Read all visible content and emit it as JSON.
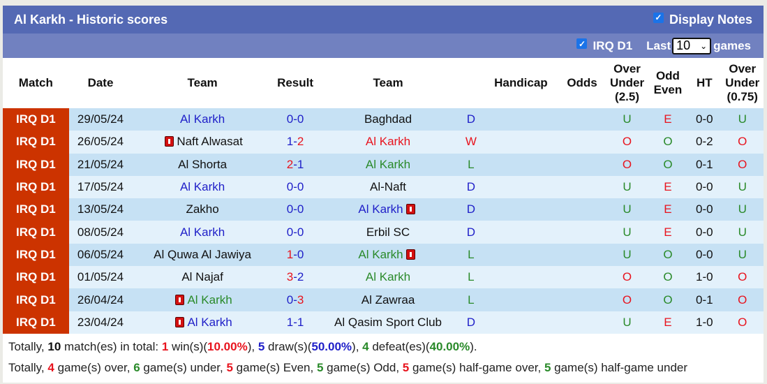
{
  "title": "Al Karkh - Historic scores",
  "display_notes": {
    "label": "Display Notes",
    "checked": true
  },
  "filter": {
    "league_label": "IRQ D1",
    "league_checked": true,
    "last_label": "Last",
    "last_value": "10",
    "games_label": "games"
  },
  "columns": [
    "Match",
    "Date",
    "Team",
    "Result",
    "Team",
    "",
    "Handicap",
    "Odds",
    "Over Under (2.5)",
    "Odd Even",
    "HT",
    "Over Under (0.75)"
  ],
  "columns_split": {
    "ou25": [
      "Over",
      "Under",
      "(2.5)"
    ],
    "oe": [
      "Odd",
      "Even"
    ],
    "ou075": [
      "Over",
      "Under",
      "(0.75)"
    ]
  },
  "colors": {
    "league_bg": "#cc3300",
    "header_bg": "#5469b4",
    "subheader_bg": "#7181c0",
    "row_odd": "#c6e1f4",
    "row_even": "#e3f1fb",
    "blue": "#1f1fc8",
    "red": "#e8141e",
    "green": "#2a8a2a"
  },
  "rows": [
    {
      "league": "IRQ D1",
      "date": "29/05/24",
      "home": "Al Karkh",
      "home_color": "blue",
      "home_card": false,
      "score_h": "0",
      "score_a": "0",
      "score_h_color": "blue",
      "score_a_color": "blue",
      "away": "Baghdad",
      "away_color": "black",
      "away_card": false,
      "outcome": "D",
      "outcome_color": "blue",
      "handicap": "",
      "odds": "",
      "ou": "U",
      "ou_color": "green",
      "oe": "E",
      "oe_color": "red",
      "ht": "0-0",
      "ou075": "U",
      "ou075_color": "green"
    },
    {
      "league": "IRQ D1",
      "date": "26/05/24",
      "home": "Naft Alwasat",
      "home_color": "black",
      "home_card": true,
      "score_h": "1",
      "score_a": "2",
      "score_h_color": "blue",
      "score_a_color": "red",
      "away": "Al Karkh",
      "away_color": "red",
      "away_card": false,
      "outcome": "W",
      "outcome_color": "red",
      "handicap": "",
      "odds": "",
      "ou": "O",
      "ou_color": "red",
      "oe": "O",
      "oe_color": "green",
      "ht": "0-2",
      "ou075": "O",
      "ou075_color": "red"
    },
    {
      "league": "IRQ D1",
      "date": "21/05/24",
      "home": "Al Shorta",
      "home_color": "black",
      "home_card": false,
      "score_h": "2",
      "score_a": "1",
      "score_h_color": "red",
      "score_a_color": "blue",
      "away": "Al Karkh",
      "away_color": "green",
      "away_card": false,
      "outcome": "L",
      "outcome_color": "green",
      "handicap": "",
      "odds": "",
      "ou": "O",
      "ou_color": "red",
      "oe": "O",
      "oe_color": "green",
      "ht": "0-1",
      "ou075": "O",
      "ou075_color": "red"
    },
    {
      "league": "IRQ D1",
      "date": "17/05/24",
      "home": "Al Karkh",
      "home_color": "blue",
      "home_card": false,
      "score_h": "0",
      "score_a": "0",
      "score_h_color": "blue",
      "score_a_color": "blue",
      "away": "Al-Naft",
      "away_color": "black",
      "away_card": false,
      "outcome": "D",
      "outcome_color": "blue",
      "handicap": "",
      "odds": "",
      "ou": "U",
      "ou_color": "green",
      "oe": "E",
      "oe_color": "red",
      "ht": "0-0",
      "ou075": "U",
      "ou075_color": "green"
    },
    {
      "league": "IRQ D1",
      "date": "13/05/24",
      "home": "Zakho",
      "home_color": "black",
      "home_card": false,
      "score_h": "0",
      "score_a": "0",
      "score_h_color": "blue",
      "score_a_color": "blue",
      "away": "Al Karkh",
      "away_color": "blue",
      "away_card": true,
      "outcome": "D",
      "outcome_color": "blue",
      "handicap": "",
      "odds": "",
      "ou": "U",
      "ou_color": "green",
      "oe": "E",
      "oe_color": "red",
      "ht": "0-0",
      "ou075": "U",
      "ou075_color": "green"
    },
    {
      "league": "IRQ D1",
      "date": "08/05/24",
      "home": "Al Karkh",
      "home_color": "blue",
      "home_card": false,
      "score_h": "0",
      "score_a": "0",
      "score_h_color": "blue",
      "score_a_color": "blue",
      "away": "Erbil SC",
      "away_color": "black",
      "away_card": false,
      "outcome": "D",
      "outcome_color": "blue",
      "handicap": "",
      "odds": "",
      "ou": "U",
      "ou_color": "green",
      "oe": "E",
      "oe_color": "red",
      "ht": "0-0",
      "ou075": "U",
      "ou075_color": "green"
    },
    {
      "league": "IRQ D1",
      "date": "06/05/24",
      "home": "Al Quwa Al Jawiya",
      "home_color": "black",
      "home_card": false,
      "score_h": "1",
      "score_a": "0",
      "score_h_color": "red",
      "score_a_color": "blue",
      "away": "Al Karkh",
      "away_color": "green",
      "away_card": true,
      "outcome": "L",
      "outcome_color": "green",
      "handicap": "",
      "odds": "",
      "ou": "U",
      "ou_color": "green",
      "oe": "O",
      "oe_color": "green",
      "ht": "0-0",
      "ou075": "U",
      "ou075_color": "green"
    },
    {
      "league": "IRQ D1",
      "date": "01/05/24",
      "home": "Al Najaf",
      "home_color": "black",
      "home_card": false,
      "score_h": "3",
      "score_a": "2",
      "score_h_color": "red",
      "score_a_color": "blue",
      "away": "Al Karkh",
      "away_color": "green",
      "away_card": false,
      "outcome": "L",
      "outcome_color": "green",
      "handicap": "",
      "odds": "",
      "ou": "O",
      "ou_color": "red",
      "oe": "O",
      "oe_color": "green",
      "ht": "1-0",
      "ou075": "O",
      "ou075_color": "red"
    },
    {
      "league": "IRQ D1",
      "date": "26/04/24",
      "home": "Al Karkh",
      "home_color": "green",
      "home_card": true,
      "score_h": "0",
      "score_a": "3",
      "score_h_color": "blue",
      "score_a_color": "red",
      "away": "Al Zawraa",
      "away_color": "black",
      "away_card": false,
      "outcome": "L",
      "outcome_color": "green",
      "handicap": "",
      "odds": "",
      "ou": "O",
      "ou_color": "red",
      "oe": "O",
      "oe_color": "green",
      "ht": "0-1",
      "ou075": "O",
      "ou075_color": "red"
    },
    {
      "league": "IRQ D1",
      "date": "23/04/24",
      "home": "Al Karkh",
      "home_color": "blue",
      "home_card": true,
      "score_h": "1",
      "score_a": "1",
      "score_h_color": "blue",
      "score_a_color": "blue",
      "away": "Al Qasim Sport Club",
      "away_color": "black",
      "away_card": false,
      "outcome": "D",
      "outcome_color": "blue",
      "handicap": "",
      "odds": "",
      "ou": "U",
      "ou_color": "green",
      "oe": "E",
      "oe_color": "red",
      "ht": "1-0",
      "ou075": "O",
      "ou075_color": "red"
    }
  ],
  "summary": {
    "line1": {
      "prefix": "Totally, ",
      "total": "10",
      "t1": " match(es) in total: ",
      "wins": "1",
      "t2": " win(s)(",
      "win_pct": "10.00%",
      "t3": "), ",
      "draws": "5",
      "t4": " draw(s)(",
      "draw_pct": "50.00%",
      "t5": "), ",
      "defeats": "4",
      "t6": " defeat(es)(",
      "defeat_pct": "40.00%",
      "t7": ")."
    },
    "line2": {
      "prefix": "Totally, ",
      "over": "4",
      "t1": " game(s) over, ",
      "under": "6",
      "t2": " game(s) under, ",
      "even": "5",
      "t3": " game(s) Even, ",
      "odd": "5",
      "t4": " game(s) Odd, ",
      "hg_over": "5",
      "t5": " game(s) half-game over, ",
      "hg_under": "5",
      "t6": " game(s) half-game under"
    }
  }
}
